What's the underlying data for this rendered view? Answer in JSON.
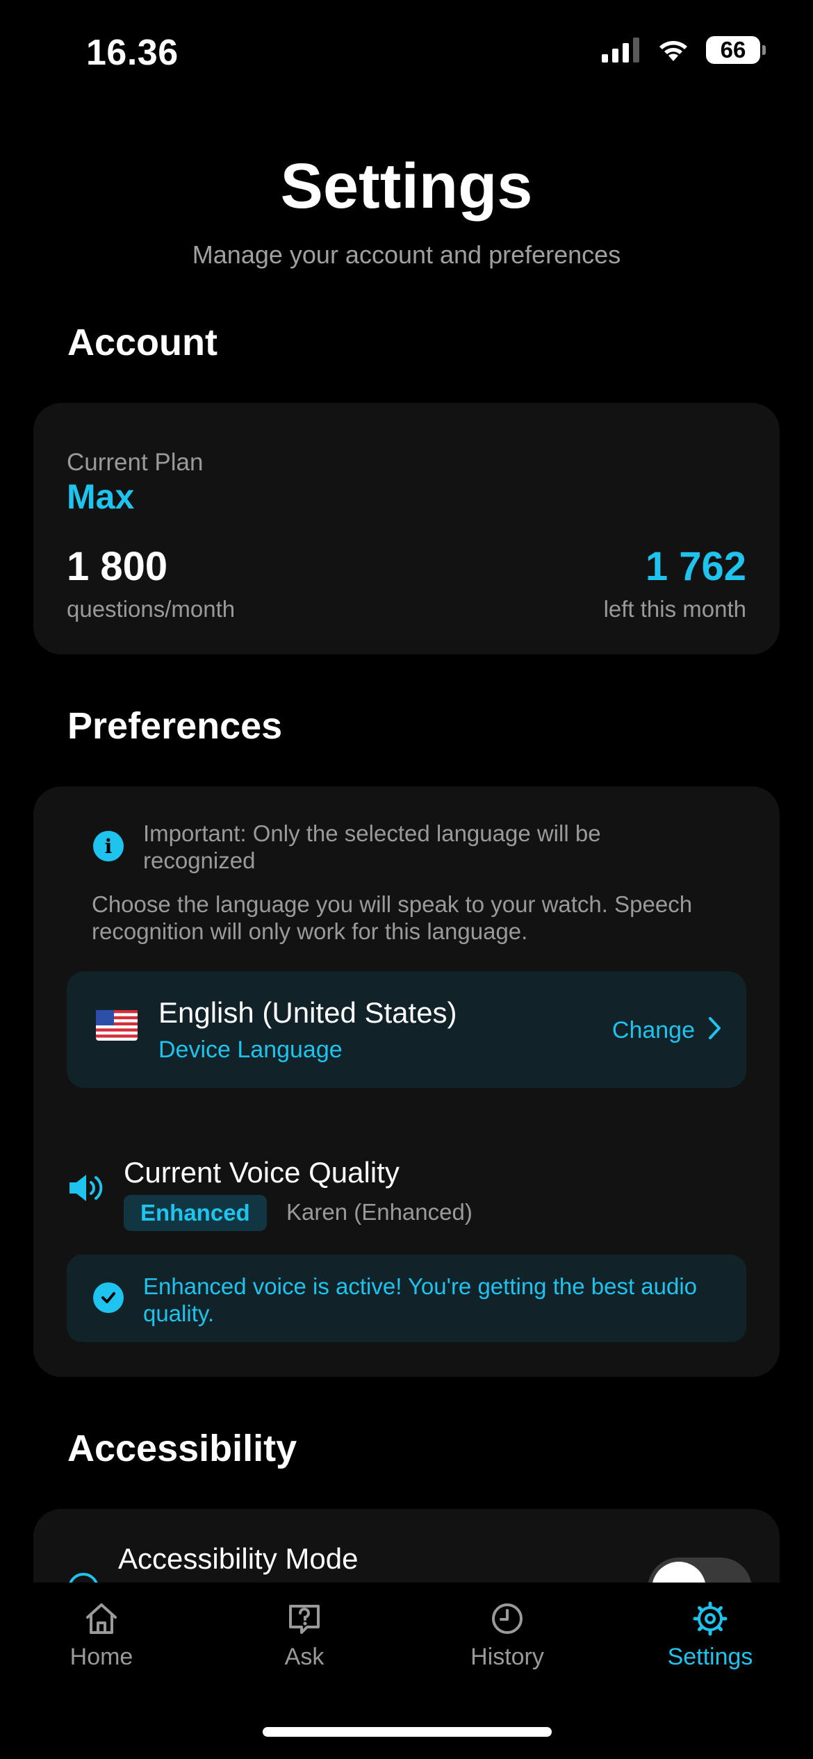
{
  "status_bar": {
    "time": "16.36",
    "battery": "66"
  },
  "header": {
    "title": "Settings",
    "subtitle": "Manage your account and preferences"
  },
  "account": {
    "section_title": "Account",
    "plan_label": "Current Plan",
    "plan_name": "Max",
    "questions_value": "1 800",
    "questions_label": "questions/month",
    "remaining_value": "1 762",
    "remaining_label": "left this month"
  },
  "preferences": {
    "section_title": "Preferences",
    "important_note": "Important: Only the selected language will be recognized",
    "language_help": "Choose the language you will speak to your watch. Speech recognition will only work for this language.",
    "language": {
      "name": "English (United States)",
      "subtitle": "Device Language",
      "change_label": "Change"
    },
    "voice": {
      "title": "Current Voice Quality",
      "badge": "Enhanced",
      "voice_name": "Karen (Enhanced)",
      "status_message": "Enhanced voice is active! You're getting the best audio quality."
    }
  },
  "accessibility": {
    "section_title": "Accessibility",
    "mode_label": "Accessibility Mode",
    "mode_enabled": true
  },
  "tabbar": {
    "tabs": [
      {
        "label": "Home",
        "icon": "home-icon"
      },
      {
        "label": "Ask",
        "icon": "question-bubble-icon"
      },
      {
        "label": "History",
        "icon": "clock-icon"
      },
      {
        "label": "Settings",
        "icon": "gear-icon"
      }
    ],
    "active": "Settings"
  },
  "colors": {
    "accent": "#1ec3ee",
    "card": "#121212",
    "highlight_box": "#112229",
    "background": "#000000"
  }
}
